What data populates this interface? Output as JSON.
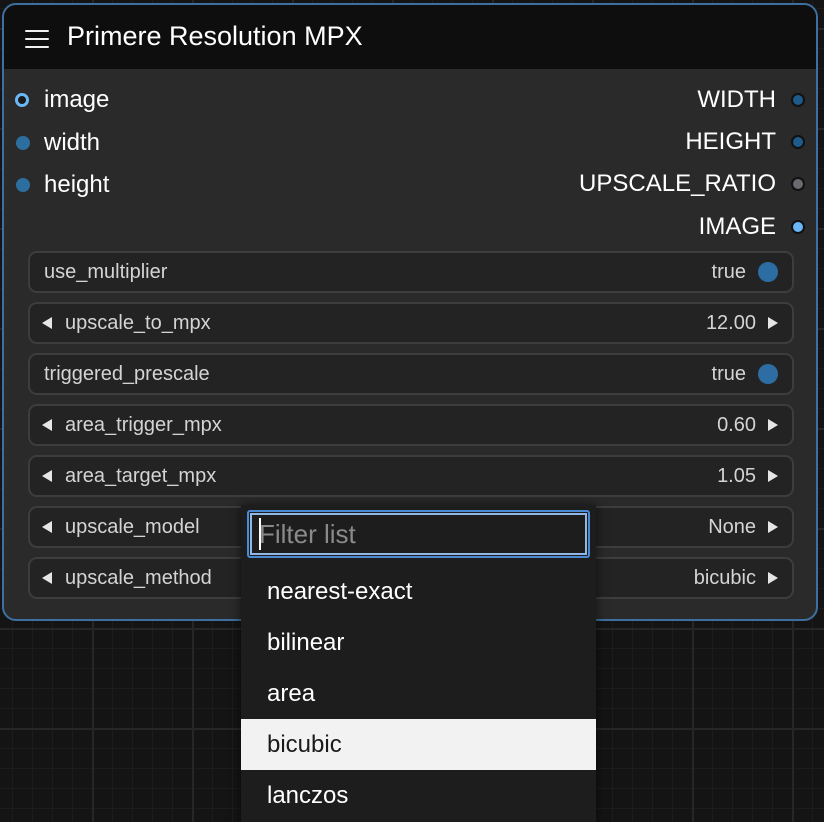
{
  "node": {
    "title": "Primere Resolution MPX",
    "menu_icon": "hamburger-menu-icon",
    "accent_border": "#3e6f9f"
  },
  "inputs": [
    {
      "label": "image",
      "connected": true,
      "color": "#6bb6f5"
    },
    {
      "label": "width",
      "connected": false,
      "color": "#2c6ea0"
    },
    {
      "label": "height",
      "connected": false,
      "color": "#2c6ea0"
    }
  ],
  "outputs": [
    {
      "label": "WIDTH",
      "color": "#1e5a8a"
    },
    {
      "label": "HEIGHT",
      "color": "#1e5a8a"
    },
    {
      "label": "UPSCALE_RATIO",
      "color": "#6a6a70"
    },
    {
      "label": "IMAGE",
      "color": "#6bb6f5"
    }
  ],
  "widgets": [
    {
      "label": "use_multiplier",
      "value": "true",
      "kind": "toggle"
    },
    {
      "label": "upscale_to_mpx",
      "value": "12.00",
      "kind": "number"
    },
    {
      "label": "triggered_prescale",
      "value": "true",
      "kind": "toggle"
    },
    {
      "label": "area_trigger_mpx",
      "value": "0.60",
      "kind": "number"
    },
    {
      "label": "area_target_mpx",
      "value": "1.05",
      "kind": "number"
    },
    {
      "label": "upscale_model",
      "value": "None",
      "kind": "combo"
    },
    {
      "label": "upscale_method",
      "value": "bicubic",
      "kind": "combo"
    }
  ],
  "toggle_color": "#2d6da3",
  "dropdown": {
    "filter_placeholder": "Filter list",
    "filter_value": "",
    "options": [
      "nearest-exact",
      "bilinear",
      "area",
      "bicubic",
      "lanczos"
    ],
    "selected": "bicubic"
  }
}
